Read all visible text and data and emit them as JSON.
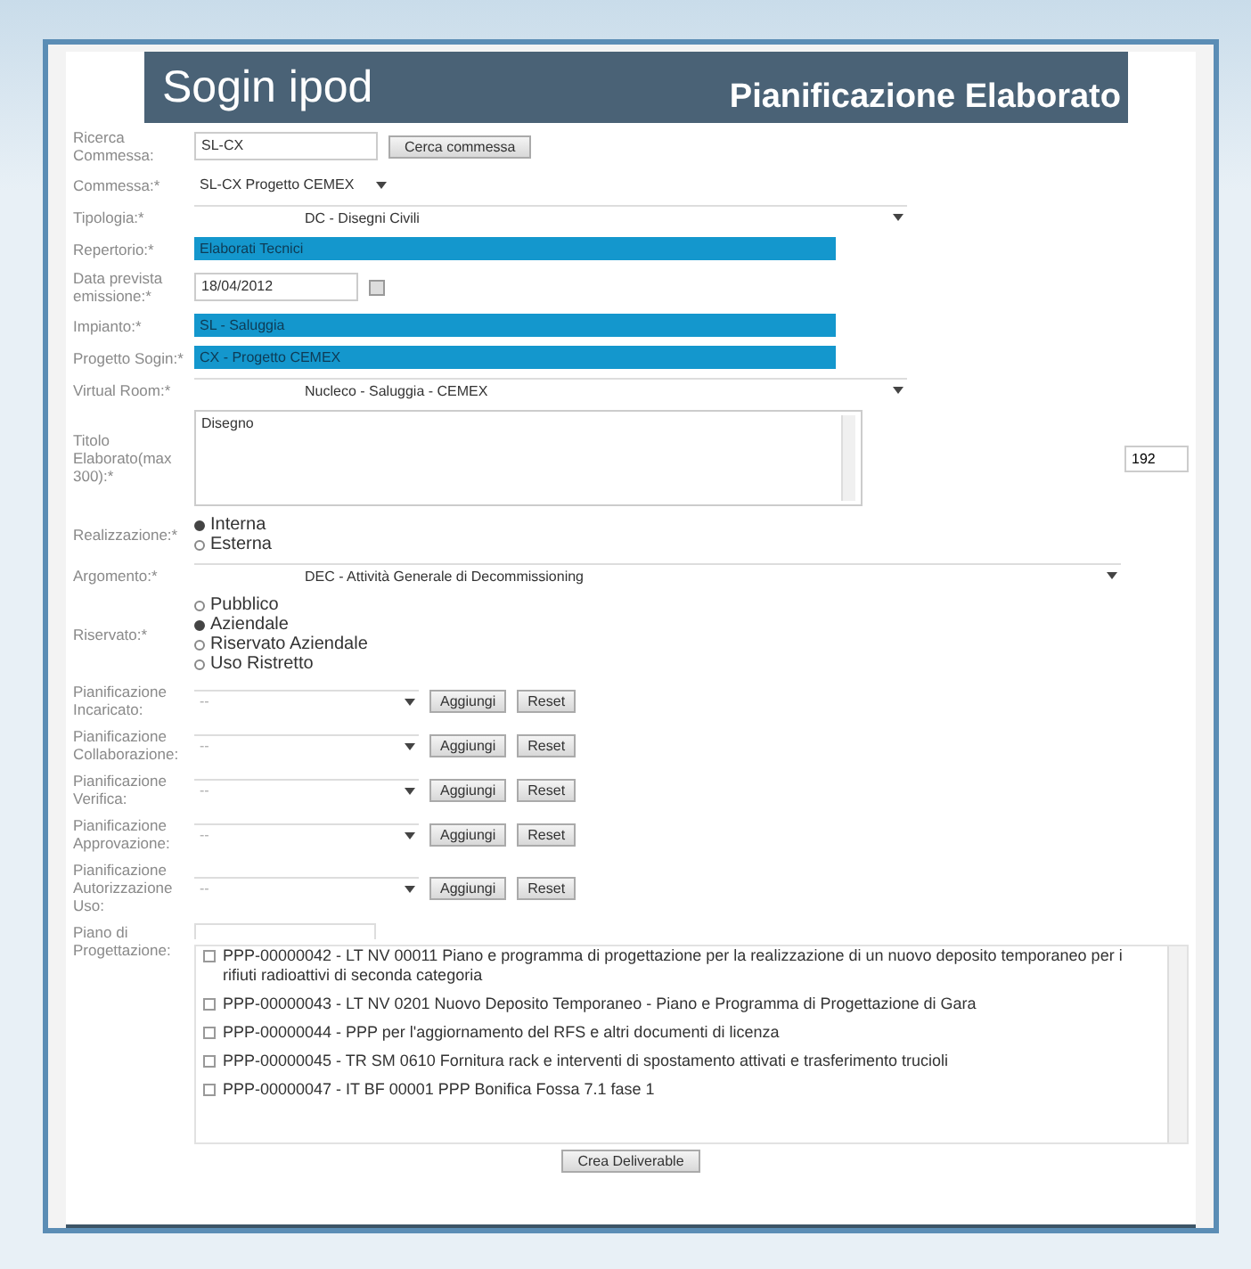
{
  "header": {
    "logo": "Sogin ipod",
    "title": "Pianificazione Elaborato"
  },
  "rows": [
    {
      "label": "Ricerca Commessa:",
      "kind": "search",
      "value": "SL-CX",
      "button": "Cerca commessa"
    },
    {
      "label": "Commessa:*",
      "kind": "combo",
      "value": "SL-CX Progetto CEMEX"
    },
    {
      "label": "Tipologia:*",
      "kind": "select",
      "value": "DC - Disegni Civili"
    },
    {
      "label": "Repertorio:*",
      "kind": "highlight",
      "value": "Elaborati Tecnici"
    },
    {
      "label": "Data prevista emissione:*",
      "kind": "date",
      "value": "18/04/2012"
    },
    {
      "label": "Impianto:*",
      "kind": "highlight",
      "value": "SL - Saluggia"
    },
    {
      "label": "Progetto Sogin:*",
      "kind": "highlight",
      "value": "CX - Progetto CEMEX"
    },
    {
      "label": "Virtual Room:*",
      "kind": "select",
      "value": "Nucleco - Saluggia - CEMEX"
    },
    {
      "label": "Titolo Elaborato(max 300):*",
      "kind": "textarea",
      "value": "Disegno",
      "counter": "192"
    },
    {
      "label": "Realizzazione:*",
      "kind": "radios",
      "options": [
        {
          "label": "Interna",
          "selected": true
        },
        {
          "label": "Esterna",
          "selected": false
        }
      ]
    },
    {
      "label": "Argomento:*",
      "kind": "wideselect",
      "value": "DEC - Attività Generale di Decommissioning"
    },
    {
      "label": "Riservato:*",
      "kind": "radios",
      "options": [
        {
          "label": "Pubblico",
          "selected": false
        },
        {
          "label": "Aziendale",
          "selected": true
        },
        {
          "label": "Riservato Aziendale",
          "selected": false
        },
        {
          "label": "Uso Ristretto",
          "selected": false
        }
      ]
    },
    {
      "label": "Pianificazione Incaricato:",
      "kind": "plan",
      "value": "--",
      "buttons": [
        "Aggiungi",
        "Reset"
      ]
    },
    {
      "label": "Pianificazione Collaborazione:",
      "kind": "plan",
      "value": "--",
      "buttons": [
        "Aggiungi",
        "Reset"
      ]
    },
    {
      "label": "Pianificazione Verifica:",
      "kind": "plan",
      "value": "--",
      "buttons": [
        "Aggiungi",
        "Reset"
      ]
    },
    {
      "label": "Pianificazione Approvazione:",
      "kind": "plan",
      "value": "--",
      "buttons": [
        "Aggiungi",
        "Reset"
      ]
    },
    {
      "label": "Pianificazione Autorizzazione Uso:",
      "kind": "plan",
      "value": "--",
      "buttons": [
        "Aggiungi",
        "Reset"
      ]
    },
    {
      "label": "Piano di Progettazione:",
      "kind": "checklist",
      "items": [
        {
          "label": "PPP-00000042 - LT NV 00011 Piano e programma di progettazione per la realizzazione di un nuovo deposito temporaneo per i rifiuti radioattivi di seconda categoria",
          "checked": false
        },
        {
          "label": "PPP-00000043 - LT NV 0201 Nuovo Deposito Temporaneo - Piano e Programma di Progettazione di Gara",
          "checked": false
        },
        {
          "label": "PPP-00000044 - PPP per l'aggiornamento del RFS e altri documenti di licenza",
          "checked": false
        },
        {
          "label": "PPP-00000045 - TR SM 0610 Fornitura rack e interventi di spostamento attivati e trasferimento trucioli",
          "checked": false
        },
        {
          "label": "PPP-00000047 - IT BF 00001 PPP Bonifica Fossa 7.1 fase 1",
          "checked": false
        }
      ]
    }
  ],
  "submit": "Crea Deliverable"
}
